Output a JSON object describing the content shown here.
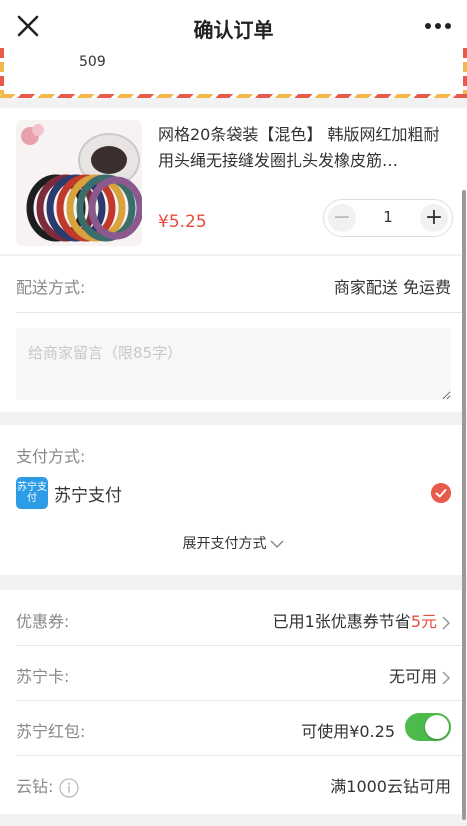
{
  "header": {
    "title": "确认订单",
    "close_icon": "close-icon",
    "more_icon": "more-icon"
  },
  "address": {
    "text": "509"
  },
  "product": {
    "name": "网格20条袋装【混色】 韩版网红加粗耐用头绳无接缝发圈扎头发橡皮筋…",
    "price": "¥5.25",
    "quantity": "1",
    "minus_label": "−",
    "plus_label": "+"
  },
  "delivery": {
    "label": "配送方式:",
    "value": "商家配送  免运费",
    "memo_placeholder": "给商家留言（限85字）"
  },
  "payment": {
    "label": "支付方式:",
    "logo_text": "苏宁支付",
    "method_name": "苏宁支付",
    "expand_label": "展开支付方式"
  },
  "discounts": {
    "coupon": {
      "label": "优惠券:",
      "value_prefix": "已用1张优惠券节省",
      "value_amount": "5元"
    },
    "card": {
      "label": "苏宁卡:",
      "value": "无可用"
    },
    "redpacket": {
      "label": "苏宁红包:",
      "value": "可使用¥0.25",
      "enabled": true
    },
    "diamond": {
      "label": "云钻:",
      "value": "满1000云钻可用"
    }
  },
  "colors": {
    "accent_red": "#e74c3c",
    "toggle_green": "#4cbb4c",
    "brand_blue": "#2d9ce6"
  }
}
